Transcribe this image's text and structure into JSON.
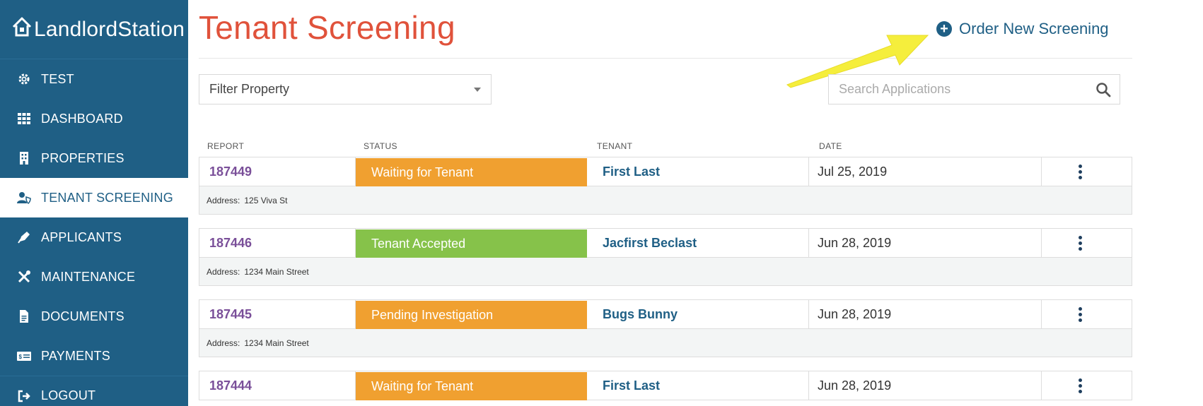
{
  "brand": {
    "name": "LandlordStation"
  },
  "sidebar": {
    "items": [
      {
        "label": "TEST",
        "icon": "gear-icon"
      },
      {
        "label": "DASHBOARD",
        "icon": "grid-icon"
      },
      {
        "label": "PROPERTIES",
        "icon": "building-icon"
      },
      {
        "label": "TENANT SCREENING",
        "icon": "user-shield-icon",
        "active": true
      },
      {
        "label": "APPLICANTS",
        "icon": "pen-icon"
      },
      {
        "label": "MAINTENANCE",
        "icon": "tools-icon"
      },
      {
        "label": "DOCUMENTS",
        "icon": "document-icon"
      },
      {
        "label": "PAYMENTS",
        "icon": "payment-card-icon"
      },
      {
        "label": "LOGOUT",
        "icon": "logout-icon"
      }
    ]
  },
  "header": {
    "title": "Tenant Screening",
    "order_button": "Order New Screening"
  },
  "filters": {
    "property_placeholder": "Filter Property",
    "search_placeholder": "Search Applications"
  },
  "table": {
    "columns": [
      "REPORT",
      "STATUS",
      "TENANT",
      "DATE"
    ],
    "address_label": "Address:",
    "rows": [
      {
        "report": "187449",
        "status": "Waiting for Tenant",
        "status_color": "#f0a030",
        "tenant": "First Last",
        "date": "Jul 25, 2019",
        "address": "125 Viva St"
      },
      {
        "report": "187446",
        "status": "Tenant Accepted",
        "status_color": "#86c24a",
        "tenant": "Jacfirst Beclast",
        "date": "Jun 28, 2019",
        "address": "1234 Main Street"
      },
      {
        "report": "187445",
        "status": "Pending Investigation",
        "status_color": "#f0a030",
        "tenant": "Bugs Bunny",
        "date": "Jun 28, 2019",
        "address": "1234 Main Street"
      },
      {
        "report": "187444",
        "status": "Waiting for Tenant",
        "status_color": "#f0a030",
        "tenant": "First Last",
        "date": "Jun 28, 2019",
        "address": ""
      }
    ]
  },
  "colors": {
    "sidebar": "#1f5f85",
    "title": "#e0523b",
    "report_link": "#7a4f99",
    "annotation_arrow": "#f5ee3c"
  }
}
